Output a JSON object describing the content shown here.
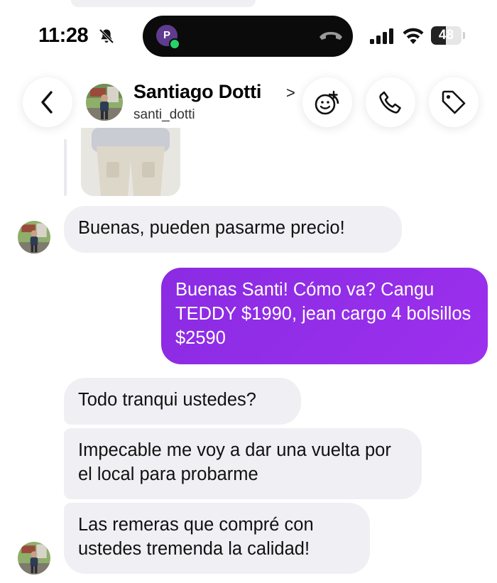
{
  "status_bar": {
    "time": "11:28",
    "island_avatar_letter": "P",
    "battery_level": "48",
    "battery_fraction": 0.48
  },
  "header": {
    "contact_name": "Santiago Dotti",
    "chevron": ">",
    "handle": "santi_dotti"
  },
  "messages": [
    {
      "direction": "incoming",
      "text": "Buenas, pueden pasarme precio!"
    },
    {
      "direction": "outgoing",
      "text": "Buenas Santi! Cómo va? Cangu TEDDY $1990, jean cargo 4 bolsillos $2590"
    },
    {
      "direction": "incoming",
      "text": "Todo tranqui ustedes?"
    },
    {
      "direction": "incoming",
      "text": "Impecable me voy a dar una vuelta por el local para probarme"
    },
    {
      "direction": "incoming",
      "text": "Las remeras que compré con ustedes tremenda la calidad!"
    }
  ],
  "colors": {
    "outgoing_bubble": "#9131ea",
    "incoming_bubble": "#efeff4"
  },
  "icons": [
    "bell-slash-icon",
    "hangup-icon",
    "signal-icon",
    "wifi-icon",
    "battery-icon",
    "back-chevron-icon",
    "stickers-icon",
    "phone-icon",
    "tag-icon"
  ]
}
